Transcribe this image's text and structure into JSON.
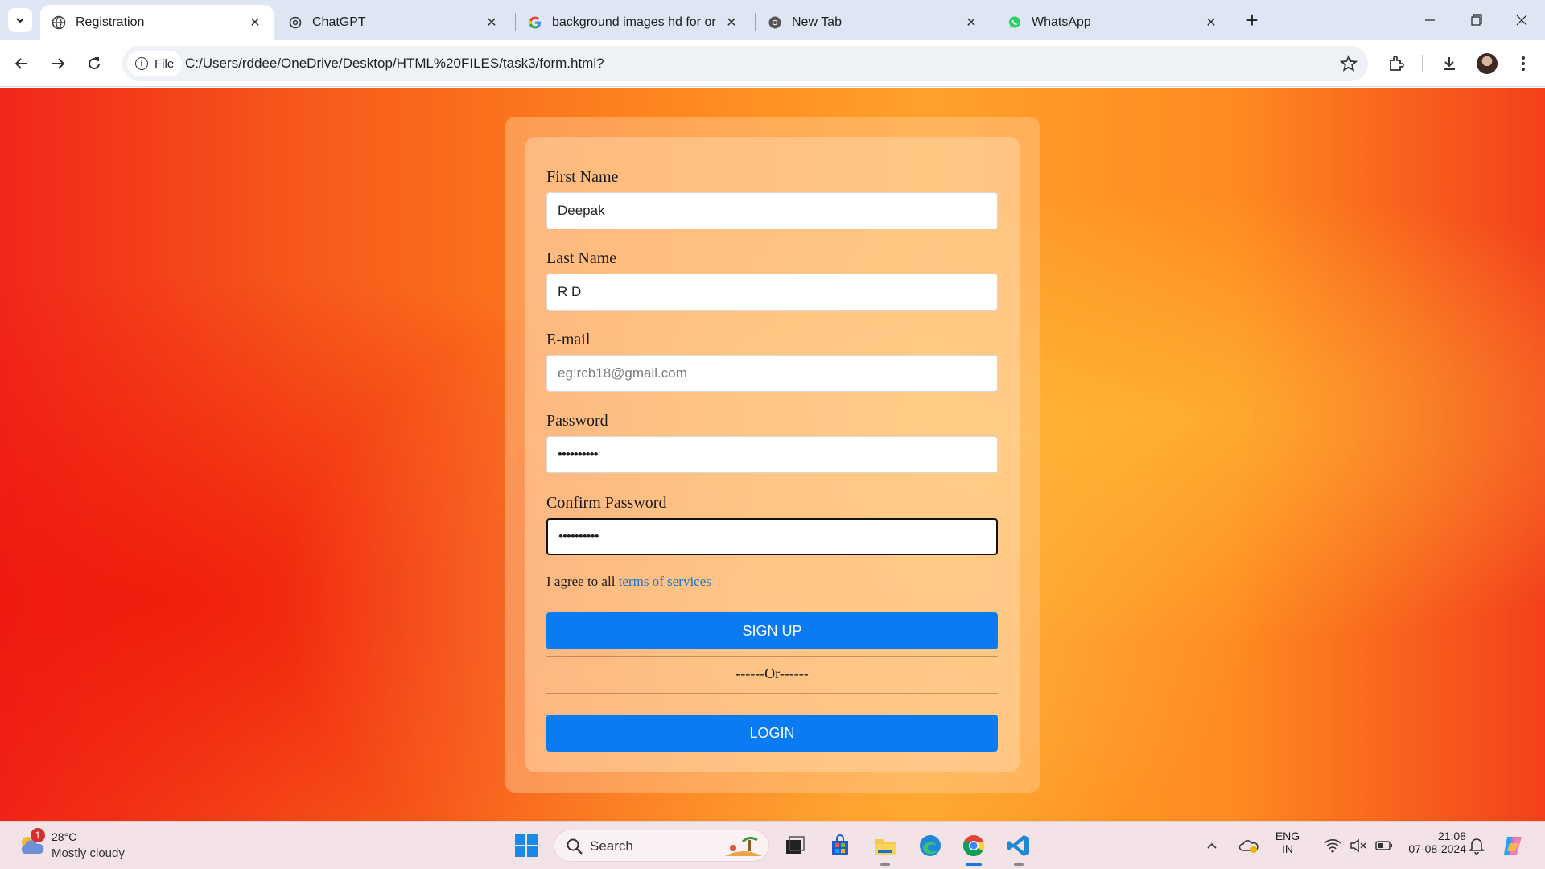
{
  "tabs": [
    {
      "title": "Registration",
      "active": true,
      "icon": "globe-icon"
    },
    {
      "title": "ChatGPT",
      "active": false,
      "icon": "chatgpt-icon"
    },
    {
      "title": "background images hd for oran",
      "active": false,
      "icon": "google-icon"
    },
    {
      "title": "New Tab",
      "active": false,
      "icon": "chrome-icon"
    },
    {
      "title": "WhatsApp",
      "active": false,
      "icon": "whatsapp-icon"
    }
  ],
  "toolbar": {
    "file_label": "File",
    "url": "C:/Users/rddee/OneDrive/Desktop/HTML%20FILES/task3/form.html?"
  },
  "form": {
    "first_name": {
      "label": "First Name",
      "value": "Deepak"
    },
    "last_name": {
      "label": "Last Name",
      "value": "R D"
    },
    "email": {
      "label": "E-mail",
      "value": "",
      "placeholder": "eg:rcb18@gmail.com"
    },
    "password": {
      "label": "Password",
      "value": "••••••••••"
    },
    "confirm_password": {
      "label": "Confirm Password",
      "value": "••••••••••"
    },
    "agree_text": "I agree to all",
    "terms_link": "terms of services",
    "signup_label": "SIGN UP",
    "or_text": "------Or------",
    "login_label": "LOGIN"
  },
  "taskbar": {
    "weather_badge": "1",
    "temperature": "28°C",
    "weather": "Mostly cloudy",
    "search_label": "Search",
    "language": "ENG",
    "region": "IN",
    "time": "21:08",
    "date": "07-08-2024"
  },
  "colors": {
    "accent_button": "#0a7bf0",
    "link": "#1676d2",
    "tabstrip": "#dfe6f3"
  }
}
